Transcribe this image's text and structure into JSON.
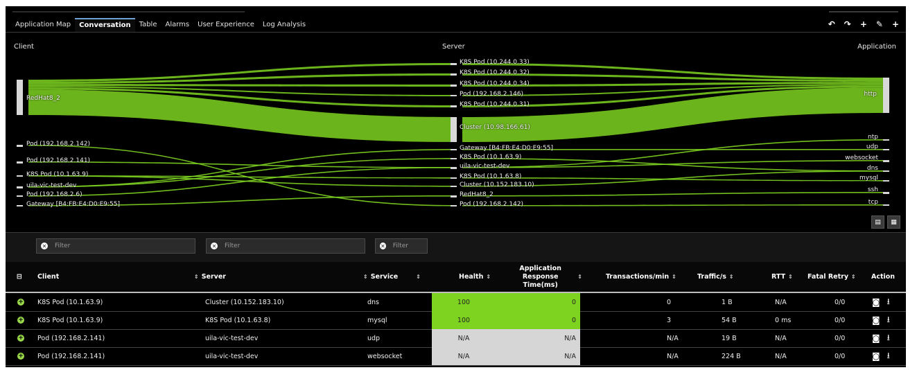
{
  "tabs": [
    "Application Map",
    "Conversation",
    "Table",
    "Alarms",
    "User Experience",
    "Log Analysis"
  ],
  "active_tab": "Conversation",
  "toolbar": {
    "undo": "↶",
    "redo": "↷",
    "add": "+",
    "edit": "✎",
    "add2": "+"
  },
  "sankey": {
    "headers": {
      "client": "Client",
      "server": "Server",
      "application": "Application"
    },
    "clients": [
      "RedHat8_2",
      "Pod (192.168.2.142)",
      "Pod (192.168.2.141)",
      "K8S Pod (10.1.63.9)",
      "uila-vic-test-dev",
      "Pod (192.168.2.6)",
      "Gateway [B4:FB:E4:D0:E9:55]"
    ],
    "servers": [
      "K8S Pod (10.244.0.33)",
      "K8S Pod (10.244.0.32)",
      "K8S Pod (10.244.0.34)",
      "Pod (192.168.2.146)",
      "K8S Pod (10.244.0.31)",
      "Cluster (10.98.166.61)",
      "Gateway [B4:FB:E4:D0:E9:55]",
      "K8S Pod (10.1.63.9)",
      "uila-vic-test-dev",
      "K8S Pod (10.1.63.8)",
      "Cluster (10.152.183.10)",
      "RedHat8_2",
      "Pod (192.168.2.142)"
    ],
    "applications": [
      "http",
      "ntp",
      "udp",
      "websocket",
      "dns",
      "mysql",
      "ssh",
      "tcp"
    ],
    "flow_color": "#7ed321"
  },
  "exports": [
    "pdf-icon",
    "csv-icon"
  ],
  "filters": {
    "client_placeholder": "Filter",
    "server_placeholder": "Filter",
    "service_placeholder": "Filter"
  },
  "table": {
    "columns": [
      "Client",
      "Server",
      "Service",
      "Health",
      "Application Response Time(ms)",
      "Transactions/min",
      "Traffic/s",
      "RTT",
      "Fatal Retry",
      "Action"
    ],
    "rows": [
      {
        "client": "K8S Pod (10.1.63.9)",
        "server": "Cluster (10.152.183.10)",
        "service": "dns",
        "health": "100",
        "art": "0",
        "tpm": "0",
        "traffic": "1 B",
        "rtt": "N/A",
        "retry": "0/0"
      },
      {
        "client": "K8S Pod (10.1.63.9)",
        "server": "K8S Pod (10.1.63.8)",
        "service": "mysql",
        "health": "100",
        "art": "0",
        "tpm": "3",
        "traffic": "54 B",
        "rtt": "0 ms",
        "retry": "0/0"
      },
      {
        "client": "Pod (192.168.2.141)",
        "server": "uila-vic-test-dev",
        "service": "udp",
        "health": "N/A",
        "art": "N/A",
        "tpm": "N/A",
        "traffic": "19 B",
        "rtt": "N/A",
        "retry": "0/0"
      },
      {
        "client": "Pod (192.168.2.141)",
        "server": "uila-vic-test-dev",
        "service": "websocket",
        "health": "N/A",
        "art": "N/A",
        "tpm": "N/A",
        "traffic": "224 B",
        "rtt": "N/A",
        "retry": "0/0"
      }
    ],
    "health_colors": {
      "good": "#7ed321",
      "na": "#d6d6d6"
    }
  }
}
